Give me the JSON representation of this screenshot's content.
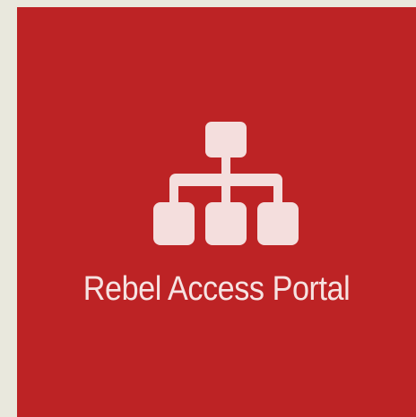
{
  "tile": {
    "label": "Rebel Access Portal",
    "icon": "sitemap-icon",
    "background_color": "#bd2325",
    "foreground_color": "#f4dedd",
    "page_background_color": "#e9e8dd"
  }
}
